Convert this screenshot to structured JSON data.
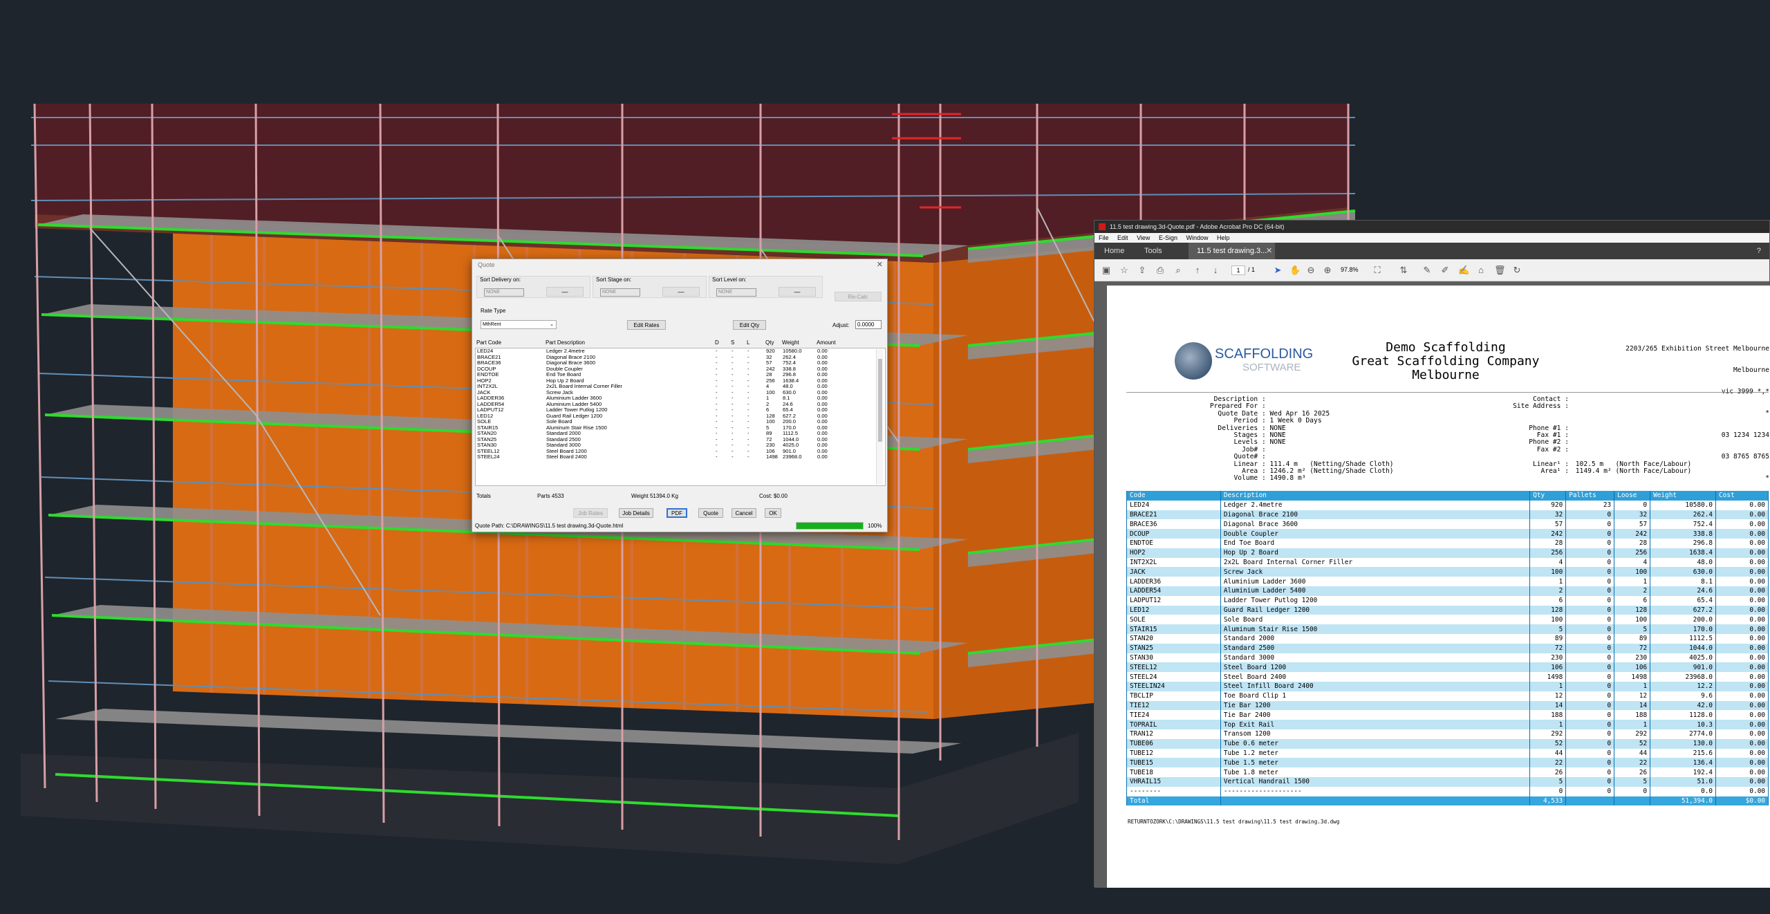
{
  "quote_dialog": {
    "title": "Quote",
    "sort_delivery_label": "Sort Delivery on:",
    "sort_stage_label": "Sort Stage on:",
    "sort_level_label": "Sort Level on:",
    "sort_value": "NONE",
    "sort_button": "—",
    "recalc_button": "Re-Calc",
    "rate_type_label": "Rate Type",
    "rate_type_value": "MthRent",
    "edit_rates_button": "Edit Rates",
    "edit_qty_button": "Edit Qty",
    "adjust_label": "Adjust:",
    "adjust_value": "0.0000",
    "columns": [
      "Part Code",
      "Part Description",
      "D",
      "S",
      "L",
      "Qty",
      "Weight",
      "Amount"
    ],
    "parts": [
      {
        "code": "LED24",
        "desc": "Ledger 2.4metre",
        "qty": "920",
        "weight": "10580.0",
        "amount": "0.00"
      },
      {
        "code": "BRACE21",
        "desc": "Diagonal Brace 2100",
        "qty": "32",
        "weight": "262.4",
        "amount": "0.00"
      },
      {
        "code": "BRACE36",
        "desc": "Diagonal Brace 3600",
        "qty": "57",
        "weight": "752.4",
        "amount": "0.00"
      },
      {
        "code": "DCOUP",
        "desc": "Double Coupler",
        "qty": "242",
        "weight": "338.8",
        "amount": "0.00"
      },
      {
        "code": "ENDTOE",
        "desc": "End Toe Board",
        "qty": "28",
        "weight": "296.8",
        "amount": "0.00"
      },
      {
        "code": "HOP2",
        "desc": "Hop Up 2 Board",
        "qty": "256",
        "weight": "1638.4",
        "amount": "0.00"
      },
      {
        "code": "INT2X2L",
        "desc": "2x2L Board Internal Corner Filler",
        "qty": "4",
        "weight": "48.0",
        "amount": "0.00"
      },
      {
        "code": "JACK",
        "desc": "Screw Jack",
        "qty": "100",
        "weight": "630.0",
        "amount": "0.00"
      },
      {
        "code": "LADDER36",
        "desc": "Aluminium Ladder 3600",
        "qty": "1",
        "weight": "8.1",
        "amount": "0.00"
      },
      {
        "code": "LADDER54",
        "desc": "Aluminium Ladder 5400",
        "qty": "2",
        "weight": "24.6",
        "amount": "0.00"
      },
      {
        "code": "LADPUT12",
        "desc": "Ladder Tower Putlog 1200",
        "qty": "6",
        "weight": "65.4",
        "amount": "0.00"
      },
      {
        "code": "LED12",
        "desc": "Guard Rail Ledger 1200",
        "qty": "128",
        "weight": "627.2",
        "amount": "0.00"
      },
      {
        "code": "SOLE",
        "desc": "Sole Board",
        "qty": "100",
        "weight": "200.0",
        "amount": "0.00"
      },
      {
        "code": "STAIR15",
        "desc": "Aluminum Stair Rise 1500",
        "qty": "5",
        "weight": "170.0",
        "amount": "0.00"
      },
      {
        "code": "STAN20",
        "desc": "Standard 2000",
        "qty": "89",
        "weight": "1112.5",
        "amount": "0.00"
      },
      {
        "code": "STAN25",
        "desc": "Standard 2500",
        "qty": "72",
        "weight": "1044.0",
        "amount": "0.00"
      },
      {
        "code": "STAN30",
        "desc": "Standard 3000",
        "qty": "230",
        "weight": "4025.0",
        "amount": "0.00"
      },
      {
        "code": "STEEL12",
        "desc": "Steel Board 1200",
        "qty": "106",
        "weight": "901.0",
        "amount": "0.00"
      },
      {
        "code": "STEEL24",
        "desc": "Steel Board 2400",
        "qty": "1498",
        "weight": "23968.0",
        "amount": "0.00"
      }
    ],
    "totals_label": "Totals",
    "parts_total": "Parts 4533",
    "weight_total": "Weight 51394.0 Kg",
    "cost_total": "Cost: $0.00",
    "buttons": {
      "job_rates": "Job Rates",
      "job_details": "Job Details",
      "pdf": "PDF",
      "quote": "Quote",
      "cancel": "Cancel",
      "ok": "OK"
    },
    "quote_path": "Quote Path: C:\\DRAWINGS\\11.5 test drawing.3d-Quote.html",
    "progress_percent": 100,
    "progress_label": "100%"
  },
  "acrobat": {
    "window_title": "11.5 test drawing.3d-Quote.pdf - Adobe Acrobat Pro DC (64-bit)",
    "menu": [
      "File",
      "Edit",
      "View",
      "E-Sign",
      "Window",
      "Help"
    ],
    "tabs": [
      "Home",
      "Tools",
      "11.5 test drawing.3..."
    ],
    "page_current": "1",
    "page_total": "/ 1",
    "zoom": "97.8%",
    "colors": {
      "header": "#2f9fd8",
      "alt_row": "#bfe4f4",
      "border": "#0a6fb0"
    },
    "doc": {
      "logo_text_1": "SCAFFOLDING",
      "logo_text_2": "SOFTWARE",
      "company_1": "Demo Scaffolding",
      "company_2": "Great Scaffolding Company",
      "company_3": "Melbourne",
      "address_1": "2203/265 Exhibition Street Melbourne",
      "address_2": "Melbourne",
      "address_3": "vic 3999 *,*",
      "address_4": "*",
      "address_5": "03 1234 1234",
      "address_6": "03 8765 8765",
      "address_7": "*",
      "address_8": "*",
      "left_info": "      Description :\n     Prepared For :\n       Quote Date : Wed Apr 16 2025\n           Period : 1 Week 0 Days\n       Deliveries : NONE\n           Stages : NONE\n           Levels : NONE\n             Job# :\n           Quote# :\n           Linear : 111.4 m   (Netting/Shade Cloth)\n             Area : 1246.2 m² (Netting/Shade Cloth)\n           Volume : 1490.8 m³",
      "right_info_labels": "    Contact :\nSite Address :\n\n\n   Phone #1 :\n     Fax #1 :\n   Phone #2 :\n     Fax #2 :\n\n    Linear¹ :\n      Area¹ :",
      "right_info_values": "\n\n\n\n\n\n\n\n\n 102.5 m   (North Face/Labour)\n 1149.4 m² (North Face/Labour)",
      "table_header": [
        "Code",
        "Description",
        "Qty",
        "Pallets",
        "Loose",
        "Weight",
        "Cost"
      ],
      "rows": [
        [
          "LED24",
          "Ledger 2.4metre",
          "920",
          "23",
          "0",
          "10580.0",
          "0.00"
        ],
        [
          "BRACE21",
          "Diagonal Brace 2100",
          "32",
          "0",
          "32",
          "262.4",
          "0.00"
        ],
        [
          "BRACE36",
          "Diagonal Brace 3600",
          "57",
          "0",
          "57",
          "752.4",
          "0.00"
        ],
        [
          "DCOUP",
          "Double Coupler",
          "242",
          "0",
          "242",
          "338.8",
          "0.00"
        ],
        [
          "ENDTOE",
          "End Toe Board",
          "28",
          "0",
          "28",
          "296.8",
          "0.00"
        ],
        [
          "HOP2",
          "Hop Up 2 Board",
          "256",
          "0",
          "256",
          "1638.4",
          "0.00"
        ],
        [
          "INT2X2L",
          "2x2L Board Internal Corner Filler",
          "4",
          "0",
          "4",
          "48.0",
          "0.00"
        ],
        [
          "JACK",
          "Screw Jack",
          "100",
          "0",
          "100",
          "630.0",
          "0.00"
        ],
        [
          "LADDER36",
          "Aluminium Ladder 3600",
          "1",
          "0",
          "1",
          "8.1",
          "0.00"
        ],
        [
          "LADDER54",
          "Aluminium Ladder 5400",
          "2",
          "0",
          "2",
          "24.6",
          "0.00"
        ],
        [
          "LADPUT12",
          "Ladder Tower Putlog 1200",
          "6",
          "0",
          "6",
          "65.4",
          "0.00"
        ],
        [
          "LED12",
          "Guard Rail Ledger 1200",
          "128",
          "0",
          "128",
          "627.2",
          "0.00"
        ],
        [
          "SOLE",
          "Sole Board",
          "100",
          "0",
          "100",
          "200.0",
          "0.00"
        ],
        [
          "STAIR15",
          "Aluminum Stair Rise 1500",
          "5",
          "0",
          "5",
          "170.0",
          "0.00"
        ],
        [
          "STAN20",
          "Standard 2000",
          "89",
          "0",
          "89",
          "1112.5",
          "0.00"
        ],
        [
          "STAN25",
          "Standard 2500",
          "72",
          "0",
          "72",
          "1044.0",
          "0.00"
        ],
        [
          "STAN30",
          "Standard 3000",
          "230",
          "0",
          "230",
          "4025.0",
          "0.00"
        ],
        [
          "STEEL12",
          "Steel Board 1200",
          "106",
          "0",
          "106",
          "901.0",
          "0.00"
        ],
        [
          "STEEL24",
          "Steel Board 2400",
          "1498",
          "0",
          "1498",
          "23968.0",
          "0.00"
        ],
        [
          "STEELIN24",
          "Steel Infill Board 2400",
          "1",
          "0",
          "1",
          "12.2",
          "0.00"
        ],
        [
          "TBCLIP",
          "Toe Board Clip 1",
          "12",
          "0",
          "12",
          "9.6",
          "0.00"
        ],
        [
          "TIE12",
          "Tie Bar 1200",
          "14",
          "0",
          "14",
          "42.0",
          "0.00"
        ],
        [
          "TIE24",
          "Tie Bar 2400",
          "188",
          "0",
          "188",
          "1128.0",
          "0.00"
        ],
        [
          "TOPRAIL",
          "Top Exit Rail",
          "1",
          "0",
          "1",
          "10.3",
          "0.00"
        ],
        [
          "TRAN12",
          "Transom 1200",
          "292",
          "0",
          "292",
          "2774.0",
          "0.00"
        ],
        [
          "TUBE06",
          "Tube 0.6 meter",
          "52",
          "0",
          "52",
          "130.0",
          "0.00"
        ],
        [
          "TUBE12",
          "Tube 1.2 meter",
          "44",
          "0",
          "44",
          "215.6",
          "0.00"
        ],
        [
          "TUBE15",
          "Tube 1.5 meter",
          "22",
          "0",
          "22",
          "136.4",
          "0.00"
        ],
        [
          "TUBE18",
          "Tube 1.8 meter",
          "26",
          "0",
          "26",
          "192.4",
          "0.00"
        ],
        [
          "VHRAIL15",
          "Vertical Handrail 1500",
          "5",
          "0",
          "5",
          "51.0",
          "0.00"
        ],
        [
          "--------",
          "--------------------",
          "0",
          "0",
          "0",
          "0.0",
          "0.00"
        ]
      ],
      "total_row": [
        "Total",
        "",
        "4,533",
        "",
        "",
        "51,394.0",
        "$0.00"
      ],
      "footer": "RETURNTOZORK\\C:\\DRAWINGS\\11.5 test drawing\\11.5 test drawing.3d.dwg"
    }
  }
}
